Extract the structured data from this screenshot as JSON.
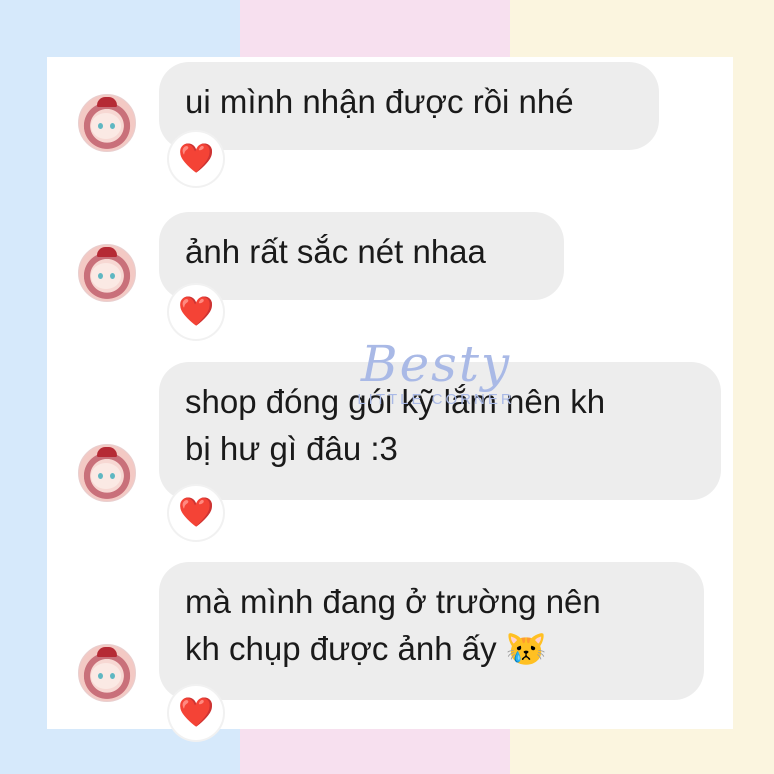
{
  "background": {
    "colors": [
      "#d6e9fb",
      "#f7e0ef",
      "#fbf5df"
    ]
  },
  "chat": {
    "messages": [
      {
        "text": "ui mình nhận được rồi nhé",
        "reaction": "❤️"
      },
      {
        "text": "ảnh rất sắc nét nhaa",
        "reaction": "❤️"
      },
      {
        "text": "shop đóng gói kỹ lắm nên kh\nbị hư gì đâu :3",
        "reaction": "❤️"
      },
      {
        "text": "mà mình đang ở trường nên\nkh chụp được ảnh ấy 😿",
        "reaction": "❤️"
      }
    ],
    "bubble_color": "#ededed",
    "reaction_color": "#e0242b"
  },
  "watermark": {
    "name": "Besty",
    "subtitle": "LITTLE CORNER",
    "color": "#a9b9e6"
  }
}
